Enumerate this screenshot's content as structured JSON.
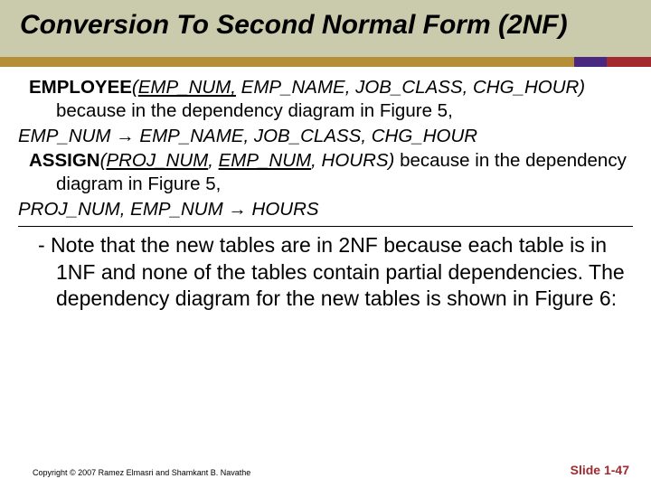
{
  "title": "Conversion To Second Normal Form (2NF)",
  "body": {
    "employee_label_bold": "EMPLOYEE",
    "emp_key": "EMP_NUM,",
    "emp_rest_italic": " EMP_NAME, JOB_CLASS, CHG_HOUR)",
    "emp_tail": " because  in the dependency diagram in Figure 5,",
    "emp_dep_lhs": "EMP_NUM ",
    "arrow": "→",
    "emp_dep_rhs": " EMP_NAME, JOB_CLASS, CHG_HOUR",
    "assign_label_bold": "ASSIGN",
    "assign_key1": "PROJ_NUM",
    "assign_sep": ", ",
    "assign_key2": "EMP_NUM",
    "assign_rest_italic": ", HOURS)",
    "assign_tail": "  because  in the dependency diagram in Figure 5,",
    "assign_dep_lhs": "PROJ_NUM, EMP_NUM ",
    "assign_dep_rhs": " HOURS",
    "note": "-  Note that the new tables are in 2NF because each table is in 1NF and none of the tables contain partial dependencies. The dependency diagram for the new tables is shown in Figure 6:"
  },
  "footer": {
    "copyright": "Copyright © 2007 Ramez Elmasri and Shamkant B. Navathe",
    "slidenum": "Slide 1-47"
  }
}
